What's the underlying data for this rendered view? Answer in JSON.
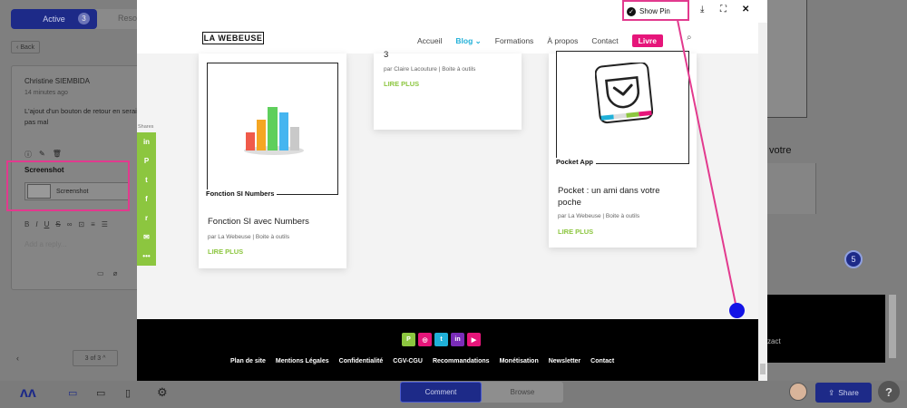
{
  "left_panel": {
    "tab_active": "Active",
    "tab_active_count": "3",
    "tab_inactive": "Reso",
    "back_label": "Back",
    "comment": {
      "author": "Christine SIEMBIDA",
      "time": "14 minutes ago",
      "text": "L'ajout d'un bouton de retour en serait pas mal",
      "screenshot_label": "Screenshot",
      "attachment_label": "Screenshot"
    },
    "reply_placeholder": "Add a reply...",
    "pager": "3 of 3"
  },
  "modal": {
    "show_pin": "Show Pin"
  },
  "site": {
    "logo": "LA WEBEUSE",
    "nav": {
      "accueil": "Accueil",
      "blog": "Blog",
      "formations": "Formations",
      "apropos": "À propos",
      "contact": "Contact",
      "livre": "Livre"
    },
    "shares_label": "Shares",
    "cards": {
      "numbers": {
        "frame_label": "Fonction SI Numbers",
        "title": "Fonction SI avec Numbers",
        "meta": "par La Webeuse | Boite à outils",
        "more": "LIRE PLUS"
      },
      "claire": {
        "title_tail": "3",
        "meta": "par Claire Lacouture | Boite à outils",
        "more": "LIRE PLUS"
      },
      "pocket": {
        "frame_label": "Pocket App",
        "title": "Pocket : un ami dans votre poche",
        "meta": "par La Webeuse | Boite à outils",
        "more": "LIRE PLUS"
      }
    },
    "footer_links": [
      "Plan de site",
      "Mentions Légales",
      "Confidentialité",
      "CGV-CGU",
      "Recommandations",
      "Monétisation",
      "Newsletter",
      "Contact"
    ]
  },
  "background": {
    "text_votre": "votre",
    "badge": "5",
    "text_zact": "zact"
  },
  "bottom_bar": {
    "comment": "Comment",
    "browse": "Browse",
    "share": "Share",
    "help": "?"
  },
  "colors": {
    "brand": "#1d2a88",
    "highlight": "#e23a8e",
    "site_green": "#8cc63f",
    "site_pink": "#e6157a",
    "site_blue": "#20b0d8",
    "pin": "#1414e6"
  }
}
